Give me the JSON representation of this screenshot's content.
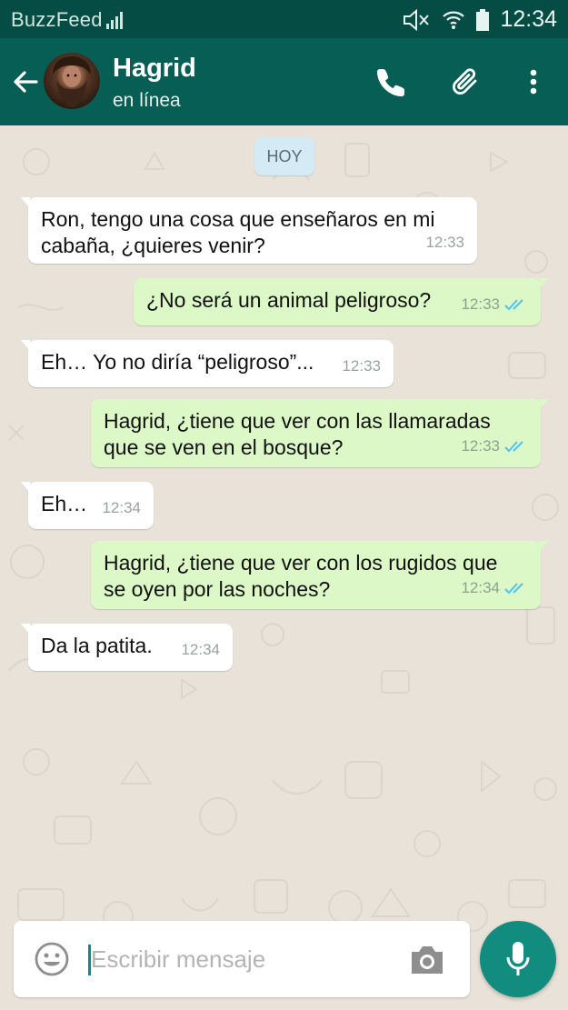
{
  "status_bar": {
    "brand": "BuzzFeed",
    "time": "12:34",
    "icons": [
      "signal-bars-icon",
      "mute-icon",
      "wifi-icon",
      "battery-icon"
    ]
  },
  "header": {
    "title": "Hagrid",
    "subtitle": "en línea",
    "icons": [
      "back-arrow-icon",
      "avatar",
      "phone-icon",
      "paperclip-icon",
      "more-vert-icon"
    ]
  },
  "chat": {
    "date_chip": "HOY",
    "messages": [
      {
        "direction": "in",
        "text": "Ron, tengo una cosa que enseñaros en mi\ncabaña, ¿quieres venir?",
        "time": "12:33"
      },
      {
        "direction": "out",
        "text": "¿No será un animal peligroso?",
        "time": "12:33",
        "status": "read"
      },
      {
        "direction": "in",
        "text": "Eh… Yo no diría “peligroso”...",
        "time": "12:33"
      },
      {
        "direction": "out",
        "text": "Hagrid, ¿tiene que ver con las llamaradas\nque se ven en el bosque?",
        "time": "12:33",
        "status": "read"
      },
      {
        "direction": "in",
        "text": "Eh…",
        "time": "12:34"
      },
      {
        "direction": "out",
        "text": "Hagrid, ¿tiene que ver con los rugidos que\nse oyen por las noches?",
        "time": "12:34",
        "status": "read"
      },
      {
        "direction": "in",
        "text": "Da la patita.",
        "time": "12:34"
      }
    ]
  },
  "input": {
    "placeholder": "Escribir mensaje",
    "icons": [
      "emoji-icon",
      "camera-icon",
      "mic-icon"
    ]
  },
  "colors": {
    "header": "#075e54",
    "status_bar": "#054d44",
    "bubble_in": "#ffffff",
    "bubble_out": "#dcf8c6",
    "read_ticks": "#4fc3f7",
    "fab": "#128c7e"
  }
}
